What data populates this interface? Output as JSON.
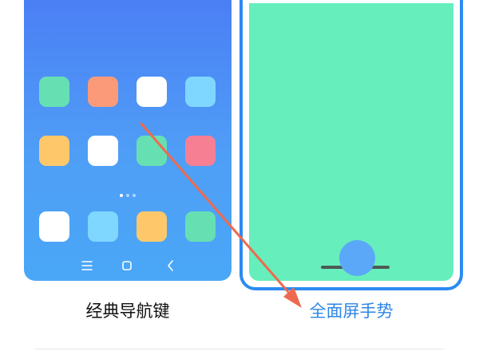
{
  "options": {
    "classic": {
      "label": "经典导航键",
      "selected": false
    },
    "gestures": {
      "label": "全面屏手势",
      "selected": true
    }
  },
  "nav_buttons": [
    "menu-icon",
    "home-icon",
    "back-icon"
  ],
  "colors": {
    "selected_accent": "#2b8bf2",
    "selected_label": "#2e86e6",
    "gesture_screen": "#66eebc",
    "annotation_arrow": "#ee6a4f",
    "wallpaper_top": "#4b7ff5",
    "wallpaper_bottom": "#4aa7f7"
  }
}
